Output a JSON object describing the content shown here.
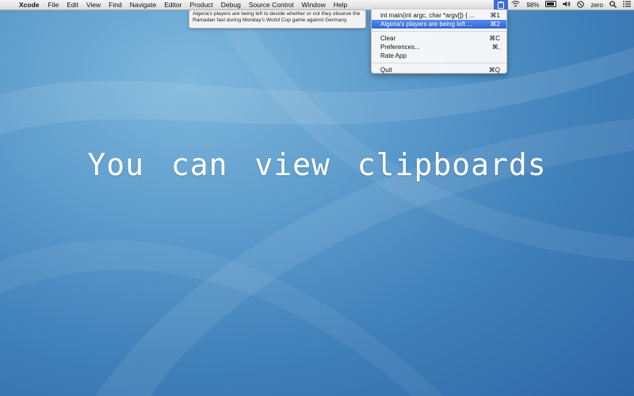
{
  "menubar": {
    "apple_glyph": "",
    "app": "Xcode",
    "items": [
      "File",
      "Edit",
      "View",
      "Find",
      "Navigate",
      "Editor",
      "Product",
      "Debug",
      "Source Control",
      "Window",
      "Help"
    ]
  },
  "status": {
    "battery_percent": "98%",
    "user": "zero"
  },
  "tooltip": {
    "text": "Algeria's players are being left to decide whether or not they observe the Ramadan fast during Monday's World Cup game against Germany."
  },
  "menu": {
    "items": [
      {
        "label": "int main(int argc, char *argv[]) {  ...",
        "shortcut": "⌘1"
      },
      {
        "label": "Algeria's players are being left ...",
        "shortcut": "⌘2"
      },
      {
        "label": "Clear",
        "shortcut": "⌘C"
      },
      {
        "label": "Preferences...",
        "shortcut": "⌘,"
      },
      {
        "label": "Rate App",
        "shortcut": ""
      },
      {
        "label": "Quit",
        "shortcut": "⌘Q"
      }
    ]
  },
  "hero": {
    "text": "You can view clipboards"
  }
}
